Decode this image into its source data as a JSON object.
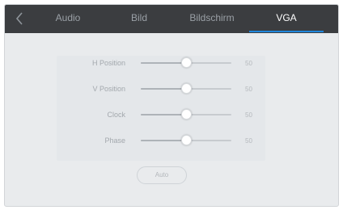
{
  "tabs": [
    {
      "label": "Audio",
      "active": false
    },
    {
      "label": "Bild",
      "active": false
    },
    {
      "label": "Bildschirm",
      "active": false
    },
    {
      "label": "VGA",
      "active": true
    }
  ],
  "settings": [
    {
      "label": "H Position",
      "value": "50",
      "level": 0.5
    },
    {
      "label": "V Position",
      "value": "50",
      "level": 0.5
    },
    {
      "label": "Clock",
      "value": "50",
      "level": 0.5
    },
    {
      "label": "Phase",
      "value": "50",
      "level": 0.5
    }
  ],
  "auto_button": {
    "label": "Auto"
  },
  "colors": {
    "accent": "#1f86dc",
    "topbar": "#3b3d40",
    "background": "#e9ebed"
  },
  "icons": {
    "back": "chevron-left-icon"
  }
}
